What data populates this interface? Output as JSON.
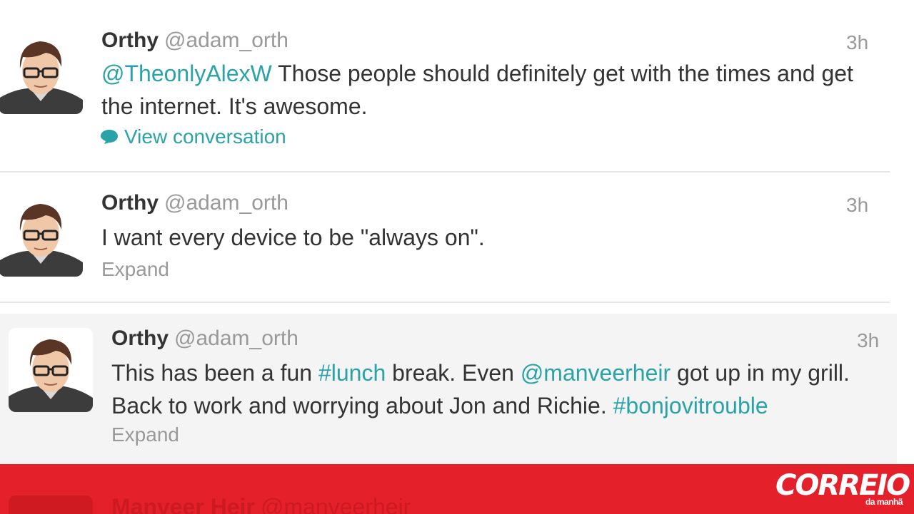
{
  "tweets": [
    {
      "name": "Orthy",
      "handle": "@adam_orth",
      "time": "3h",
      "text_parts": [
        "@TheonlyAlexW",
        " Those people should definitely get with the times and get the internet. It's awesome."
      ],
      "action": "View conversation"
    },
    {
      "name": "Orthy",
      "handle": "@adam_orth",
      "time": "3h",
      "text": "I want every device to be \"always on\".",
      "action": "Expand"
    },
    {
      "name": "Orthy",
      "handle": "@adam_orth",
      "time": "3h",
      "text_parts": [
        "This has been a fun ",
        "#lunch",
        " break. Even ",
        "@manveerheir",
        " got up in my grill. Back to work and worrying about Jon and Richie. ",
        "#bonjovitrouble"
      ],
      "action": "Expand"
    }
  ],
  "next_tweet": {
    "name": "Manveer Heir",
    "handle": "@manveerheir"
  },
  "logo": {
    "word": "CORREIO",
    "sub": "da manhã"
  },
  "colors": {
    "link": "#2aa3a8",
    "muted": "#999999",
    "banner": "#e4202a",
    "highlight_bg": "#f4f4f4"
  },
  "icons": {
    "conversation": "speech-bubble-icon"
  }
}
